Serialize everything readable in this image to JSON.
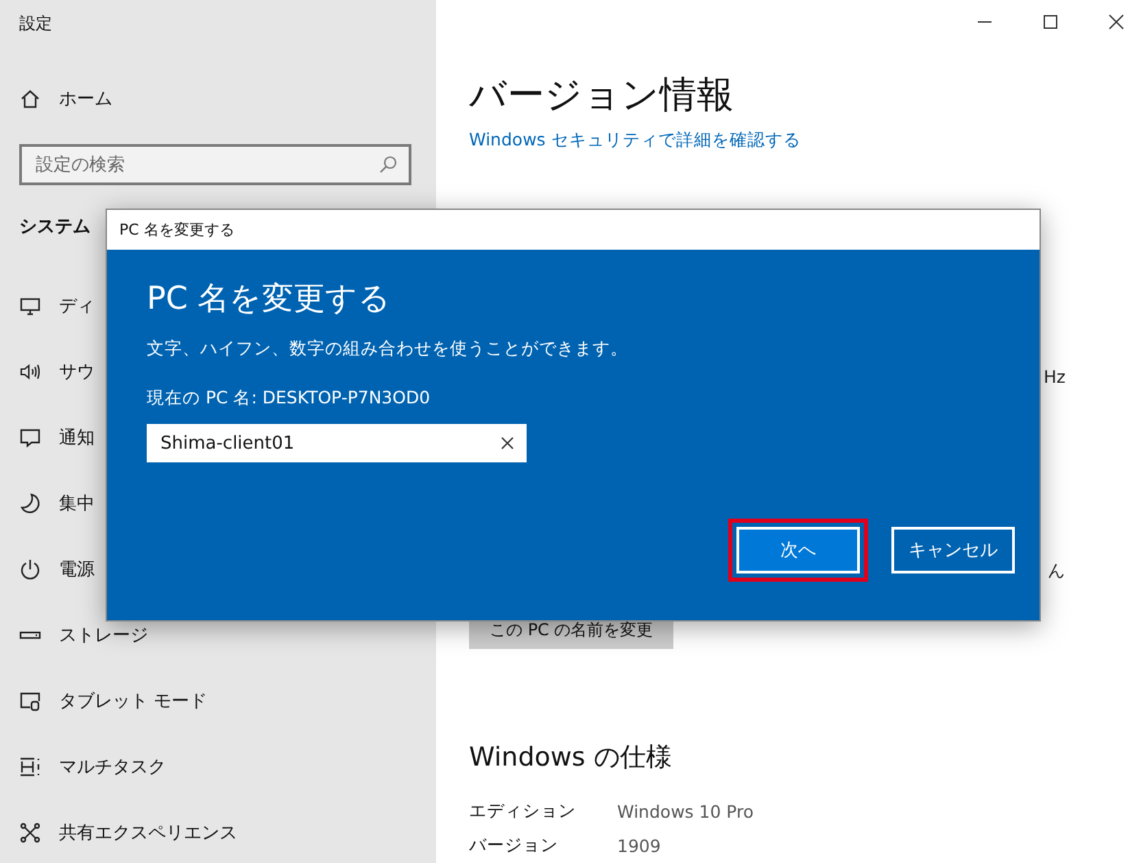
{
  "window": {
    "title": "設定"
  },
  "sidebar": {
    "home": "ホーム",
    "search": {
      "placeholder": "設定の検索"
    },
    "section": "システム",
    "items": [
      {
        "label": "ディ"
      },
      {
        "label": "サウ"
      },
      {
        "label": "通知"
      },
      {
        "label": "集中"
      },
      {
        "label": "電源"
      },
      {
        "label": "ストレージ"
      },
      {
        "label": "タブレット モード"
      },
      {
        "label": "マルチタスク"
      },
      {
        "label": "共有エクスペリエンス"
      }
    ]
  },
  "content": {
    "heading": "バージョン情報",
    "link": "Windows セキュリティで詳細を確認する",
    "fragment_1": "Hz",
    "fragment_2": "ん",
    "rename_button": "この PC の名前を変更",
    "spec_heading": "Windows の仕様",
    "specs": [
      {
        "label": "エディション",
        "value": "Windows 10 Pro"
      },
      {
        "label": "バージョン",
        "value": "1909"
      }
    ]
  },
  "dialog": {
    "title": "PC 名を変更する",
    "heading": "PC 名を変更する",
    "description": "文字、ハイフン、数字の組み合わせを使うことができます。",
    "current_name": "現在の PC 名: DESKTOP-P7N3OD0",
    "input": {
      "value": "Shima-client01"
    },
    "buttons": [
      {
        "label": "次へ",
        "kind": "primary",
        "highlighted": true
      },
      {
        "label": "キャンセル",
        "kind": "secondary",
        "highlighted": false
      }
    ]
  }
}
